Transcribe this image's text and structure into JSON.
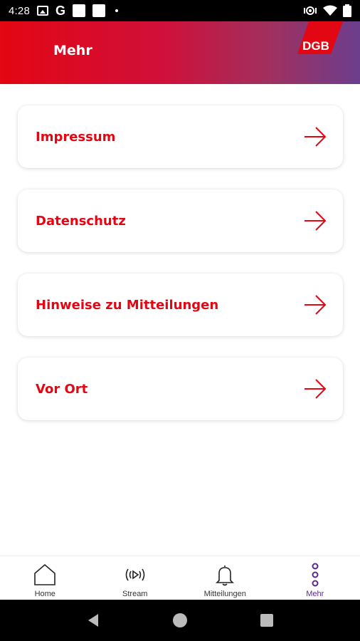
{
  "status_bar": {
    "time": "4:28",
    "left_icons": [
      "image-icon",
      "google-icon",
      "notification-square-icon",
      "notification-square-icon",
      "dot-icon"
    ],
    "right_icons": [
      "vibrate-icon",
      "wifi-icon",
      "battery-icon"
    ]
  },
  "header": {
    "title": "Mehr",
    "logo_text": "DGB",
    "gradient": [
      "#e30613",
      "#6b3e8e"
    ]
  },
  "menu": {
    "items": [
      {
        "label": "Impressum",
        "icon": "arrow-right-icon"
      },
      {
        "label": "Datenschutz",
        "icon": "arrow-right-icon"
      },
      {
        "label": "Hinweise zu Mitteilungen",
        "icon": "arrow-right-icon"
      },
      {
        "label": "Vor Ort",
        "icon": "arrow-right-icon"
      }
    ]
  },
  "bottom_nav": {
    "items": [
      {
        "label": "Home",
        "icon": "home-icon",
        "active": false
      },
      {
        "label": "Stream",
        "icon": "stream-icon",
        "active": false
      },
      {
        "label": "Mitteilungen",
        "icon": "bell-icon",
        "active": false
      },
      {
        "label": "Mehr",
        "icon": "more-icon",
        "active": true
      }
    ],
    "active_color": "#5b2a8c"
  },
  "colors": {
    "accent": "#e30613",
    "card_bg": "#ffffff"
  }
}
